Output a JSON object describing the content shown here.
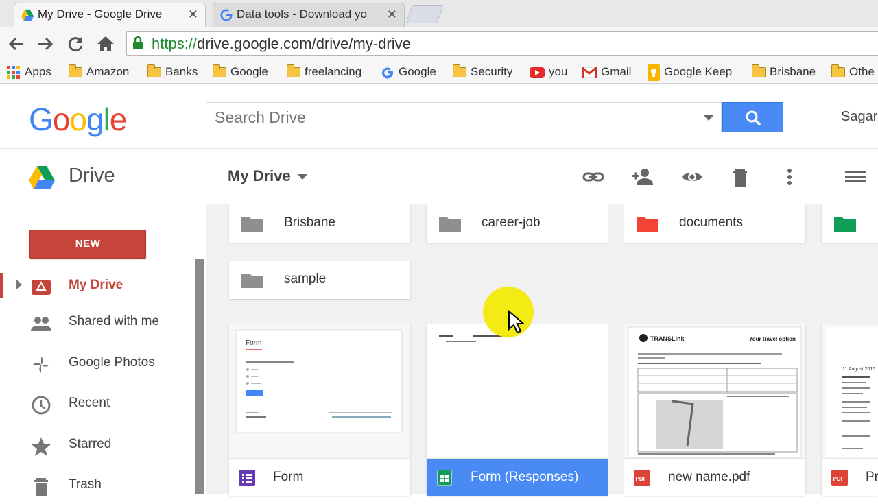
{
  "browser": {
    "tabs": [
      {
        "title": "My Drive - Google Drive",
        "active": true
      },
      {
        "title": "Data tools - Download yo",
        "active": false
      }
    ],
    "url_secure": "https://",
    "url_rest": "drive.google.com/drive/my-drive",
    "bookmarks": [
      {
        "label": "Apps",
        "icon": "apps-grid-icon"
      },
      {
        "label": "Amazon",
        "icon": "folder-icon"
      },
      {
        "label": "Banks",
        "icon": "folder-icon"
      },
      {
        "label": "Google",
        "icon": "folder-icon"
      },
      {
        "label": "freelancing",
        "icon": "folder-icon"
      },
      {
        "label": "Google",
        "icon": "google-g-icon"
      },
      {
        "label": "Security",
        "icon": "folder-icon"
      },
      {
        "label": "you",
        "icon": "youtube-icon"
      },
      {
        "label": "Gmail",
        "icon": "gmail-icon"
      },
      {
        "label": "Google Keep",
        "icon": "keep-icon"
      },
      {
        "label": "Brisbane",
        "icon": "folder-icon"
      },
      {
        "label": "Othe",
        "icon": "folder-icon"
      }
    ]
  },
  "header": {
    "logo": [
      "G",
      "o",
      "o",
      "g",
      "l",
      "e"
    ],
    "logo_colors": [
      "#4285f4",
      "#ea4335",
      "#fbbc05",
      "#4285f4",
      "#34a853",
      "#ea4335"
    ],
    "search_placeholder": "Search Drive",
    "user_name": "Sagar"
  },
  "subheader": {
    "app_title": "Drive",
    "location": "My Drive"
  },
  "sidebar": {
    "new_label": "NEW",
    "items": [
      {
        "label": "My Drive",
        "icon": "my-drive-icon",
        "active": true
      },
      {
        "label": "Shared with me",
        "icon": "people-icon",
        "active": false
      },
      {
        "label": "Google Photos",
        "icon": "pinwheel-icon",
        "active": false
      },
      {
        "label": "Recent",
        "icon": "clock-icon",
        "active": false
      },
      {
        "label": "Starred",
        "icon": "star-icon",
        "active": false
      },
      {
        "label": "Trash",
        "icon": "trash-icon",
        "active": false
      }
    ]
  },
  "folders": [
    {
      "name": "Brisbane",
      "color": "#8f8f8f"
    },
    {
      "name": "career-job",
      "color": "#8f8f8f"
    },
    {
      "name": "documents",
      "color": "#f44336"
    },
    {
      "name": "",
      "color": "#0f9d58"
    },
    {
      "name": "sample",
      "color": "#8f8f8f"
    }
  ],
  "files": [
    {
      "name": "Form",
      "type": "forms",
      "selected": false
    },
    {
      "name": "Form (Responses)",
      "type": "sheets",
      "selected": true
    },
    {
      "name": "new name.pdf",
      "type": "pdf",
      "selected": false
    },
    {
      "name": "Pr",
      "type": "pdf",
      "selected": false
    }
  ],
  "thumbs": {
    "form_title": "Form",
    "translink_brand": "TRANSLink",
    "translink_heading": "Your travel option",
    "doc_date": "11 August 2015"
  },
  "colors": {
    "accent": "#4a8af4",
    "new_button": "#c5453b",
    "forms_icon": "#673ab7",
    "sheets_icon": "#0f9d58",
    "pdf_icon": "#db4437"
  }
}
